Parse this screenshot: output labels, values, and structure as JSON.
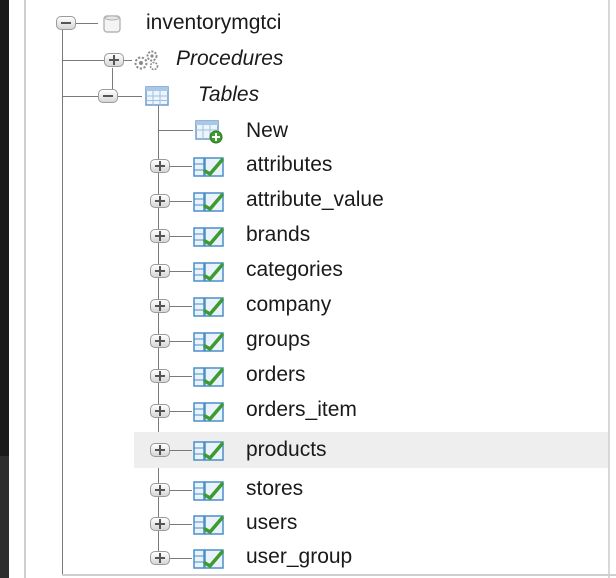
{
  "tree": {
    "database": {
      "name": "inventorymgtci",
      "icon": "database-icon",
      "expanded": true
    },
    "procedures": {
      "label": "Procedures",
      "icon": "procedures-icon",
      "expanded": false
    },
    "tables": {
      "label": "Tables",
      "icon": "tables-icon",
      "expanded": true,
      "new_label": "New",
      "items": [
        {
          "label": "attributes"
        },
        {
          "label": "attribute_value"
        },
        {
          "label": "brands"
        },
        {
          "label": "categories"
        },
        {
          "label": "company"
        },
        {
          "label": "groups"
        },
        {
          "label": "orders"
        },
        {
          "label": "orders_item"
        },
        {
          "label": "products",
          "hovered": true
        },
        {
          "label": "stores"
        },
        {
          "label": "users"
        },
        {
          "label": "user_group"
        }
      ]
    }
  },
  "colors": {
    "table_icon_green": "#3e9b2f",
    "table_icon_blue": "#4a8fc7",
    "hover_row": "#eeeeee"
  }
}
